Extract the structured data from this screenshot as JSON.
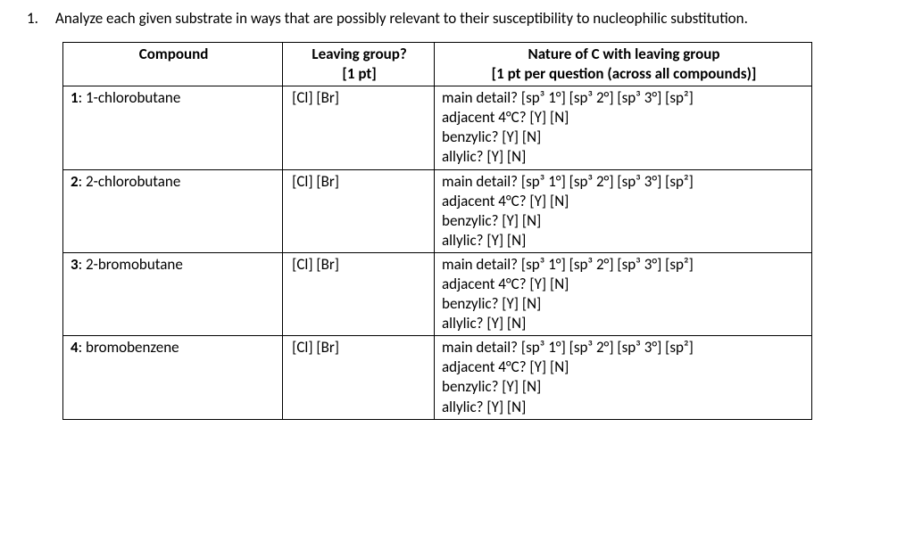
{
  "question": {
    "number": "1.",
    "text": "Analyze each given substrate in ways that are possibly relevant to their susceptibility to nucleophilic substitution."
  },
  "headers": {
    "compound": "Compound",
    "leaving_line1": "Leaving group?",
    "leaving_line2": "[1 pt]",
    "nature_line1": "Nature of C with leaving group",
    "nature_line2": "[1 pt per question (across all compounds)]"
  },
  "opts": {
    "lg": "[Cl] [Br]",
    "main": "main detail? [sp³ 1°] [sp³ 2°] [sp³ 3°] [sp²]",
    "adj": "adjacent 4°C? [Y] [N]",
    "benz": "benzylic? [Y] [N]",
    "ally": "allylic? [Y] [N]"
  },
  "rows": [
    {
      "label_bold": "1",
      "label_rest": ": 1-chlorobutane"
    },
    {
      "label_bold": "2",
      "label_rest": ": 2-chlorobutane"
    },
    {
      "label_bold": "3",
      "label_rest": ": 2-bromobutane"
    },
    {
      "label_bold": "4",
      "label_rest": ": bromobenzene"
    }
  ]
}
